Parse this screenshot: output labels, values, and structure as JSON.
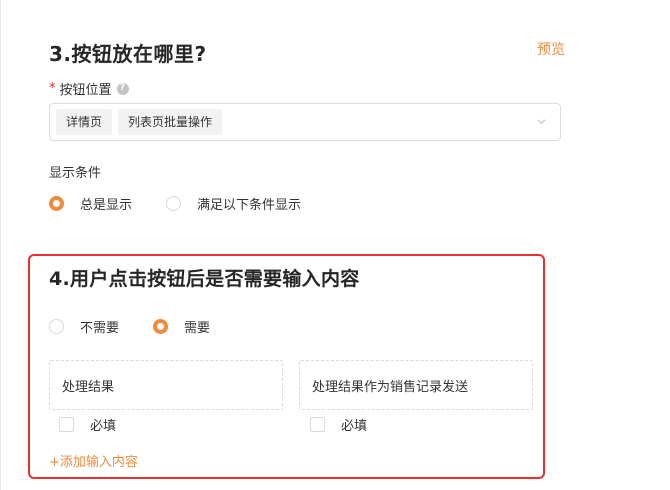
{
  "section3": {
    "title": "3.按钮放在哪里?",
    "preview_label": "预览",
    "position": {
      "required_mark": "*",
      "label": "按钮位置",
      "help_icon": "question-circle-icon",
      "tags": [
        "详情页",
        "列表页批量操作"
      ],
      "dropdown_icon": "chevron-down-icon"
    },
    "display_condition": {
      "label": "显示条件",
      "options": [
        {
          "label": "总是显示",
          "checked": true
        },
        {
          "label": "满足以下条件显示",
          "checked": false
        }
      ]
    }
  },
  "section4": {
    "title": "4.用户点击按钮后是否需要输入内容",
    "options": [
      {
        "label": "不需要",
        "checked": false
      },
      {
        "label": "需要",
        "checked": true
      }
    ],
    "fields": [
      {
        "name": "处理结果",
        "required_label": "必填"
      },
      {
        "name": "处理结果作为销售记录发送",
        "required_label": "必填"
      }
    ],
    "add_label": "+添加输入内容"
  },
  "colors": {
    "accent": "#f08a3c",
    "highlight_border": "#e8302e",
    "required": "#f5222d"
  }
}
